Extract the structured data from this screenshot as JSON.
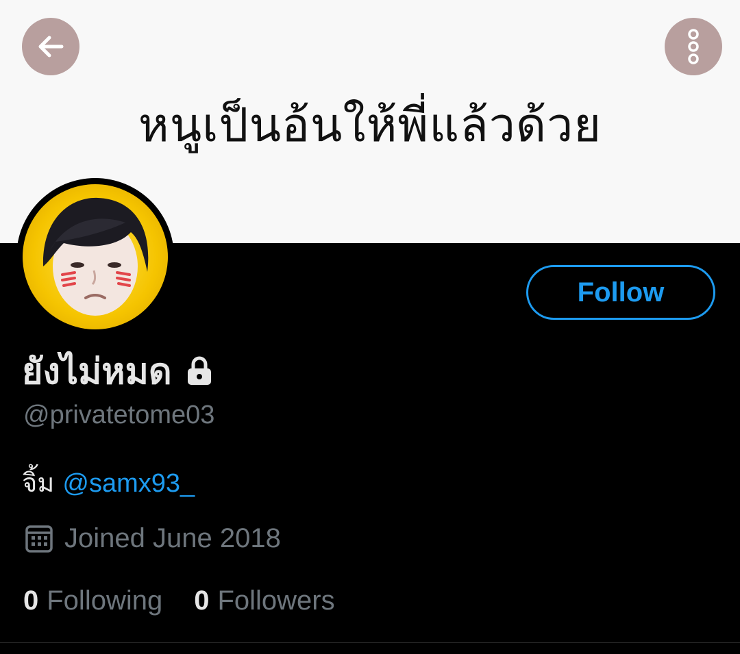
{
  "banner": {
    "text": "หนูเป็นอ้นให้พี่แล้วด้วย"
  },
  "header": {
    "back_icon": "arrow-left-icon",
    "more_icon": "more-vertical-icon"
  },
  "profile": {
    "display_name": "ยังไม่หมด",
    "lock_icon": "lock-icon",
    "handle": "@privatetome03",
    "bio_text": "จิ้ม ",
    "bio_mention": "@samx93_",
    "joined_icon": "calendar-icon",
    "joined": "Joined June 2018",
    "following_count": "0",
    "following_label": "Following",
    "followers_count": "0",
    "followers_label": "Followers",
    "follow_label": "Follow"
  },
  "colors": {
    "accent": "#1d9bf0",
    "header_button_bg": "#b89f9e",
    "muted_text": "#6e767d"
  }
}
